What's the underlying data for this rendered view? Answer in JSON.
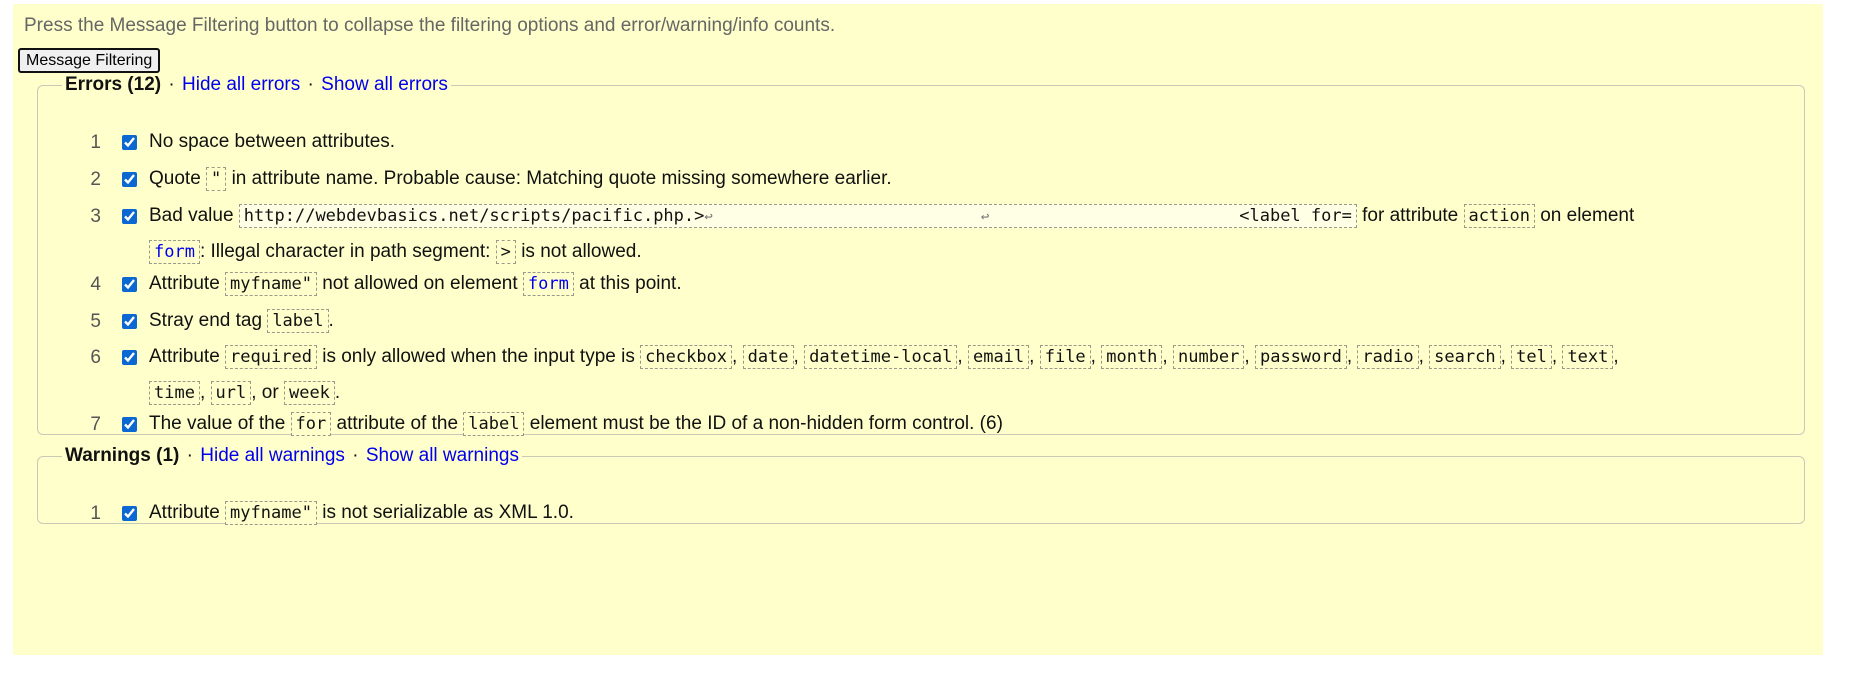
{
  "intro": "Press the Message Filtering button to collapse the filtering options and error/warning/info counts.",
  "filter_button": "Message Filtering",
  "errors": {
    "title": "Errors (12)",
    "sep": "·",
    "hide": "Hide all errors",
    "show": "Show all errors",
    "items": [
      {
        "n": "1",
        "t1": "No space between attributes."
      },
      {
        "n": "2",
        "t1": "Quote",
        "c1": "\"",
        "t2": "in attribute name. Probable cause: Matching quote missing somewhere earlier."
      },
      {
        "n": "3",
        "t1": "Bad value",
        "c1a": "http://webdevbasics.net/scripts/pacific.php.>",
        "c1b": "<label for=",
        "ret": "↩",
        "t2": "for attribute",
        "c2": "action",
        "t3": "on element",
        "c3": "form",
        "t4": ": Illegal character in path segment:",
        "c4": ">",
        "t5": "is not allowed."
      },
      {
        "n": "4",
        "t1": "Attribute",
        "c1": "myfname\"",
        "t2": "not allowed on element",
        "c2": "form",
        "t3": "at this point."
      },
      {
        "n": "5",
        "t1": "Stray end tag",
        "c1": "label",
        "t2": "."
      },
      {
        "n": "6",
        "t1": "Attribute",
        "c1": "required",
        "t2": "is only allowed when the input type is",
        "types": [
          "checkbox",
          "date",
          "datetime-local",
          "email",
          "file",
          "month",
          "number",
          "password",
          "radio",
          "search",
          "tel",
          "text",
          "time",
          "url",
          "week"
        ],
        "or": ", or"
      },
      {
        "n": "7",
        "t1": "The value of the",
        "c1": "for",
        "t2": "attribute of the",
        "c2": "label",
        "t3": "element must be the ID of a non-hidden form control. (6)"
      }
    ]
  },
  "warnings": {
    "title": "Warnings (1)",
    "sep": "·",
    "hide": "Hide all warnings",
    "show": "Show all warnings",
    "items": [
      {
        "n": "1",
        "t1": "Attribute",
        "c1": "myfname\"",
        "t2": "is not serializable as XML 1.0."
      }
    ]
  }
}
